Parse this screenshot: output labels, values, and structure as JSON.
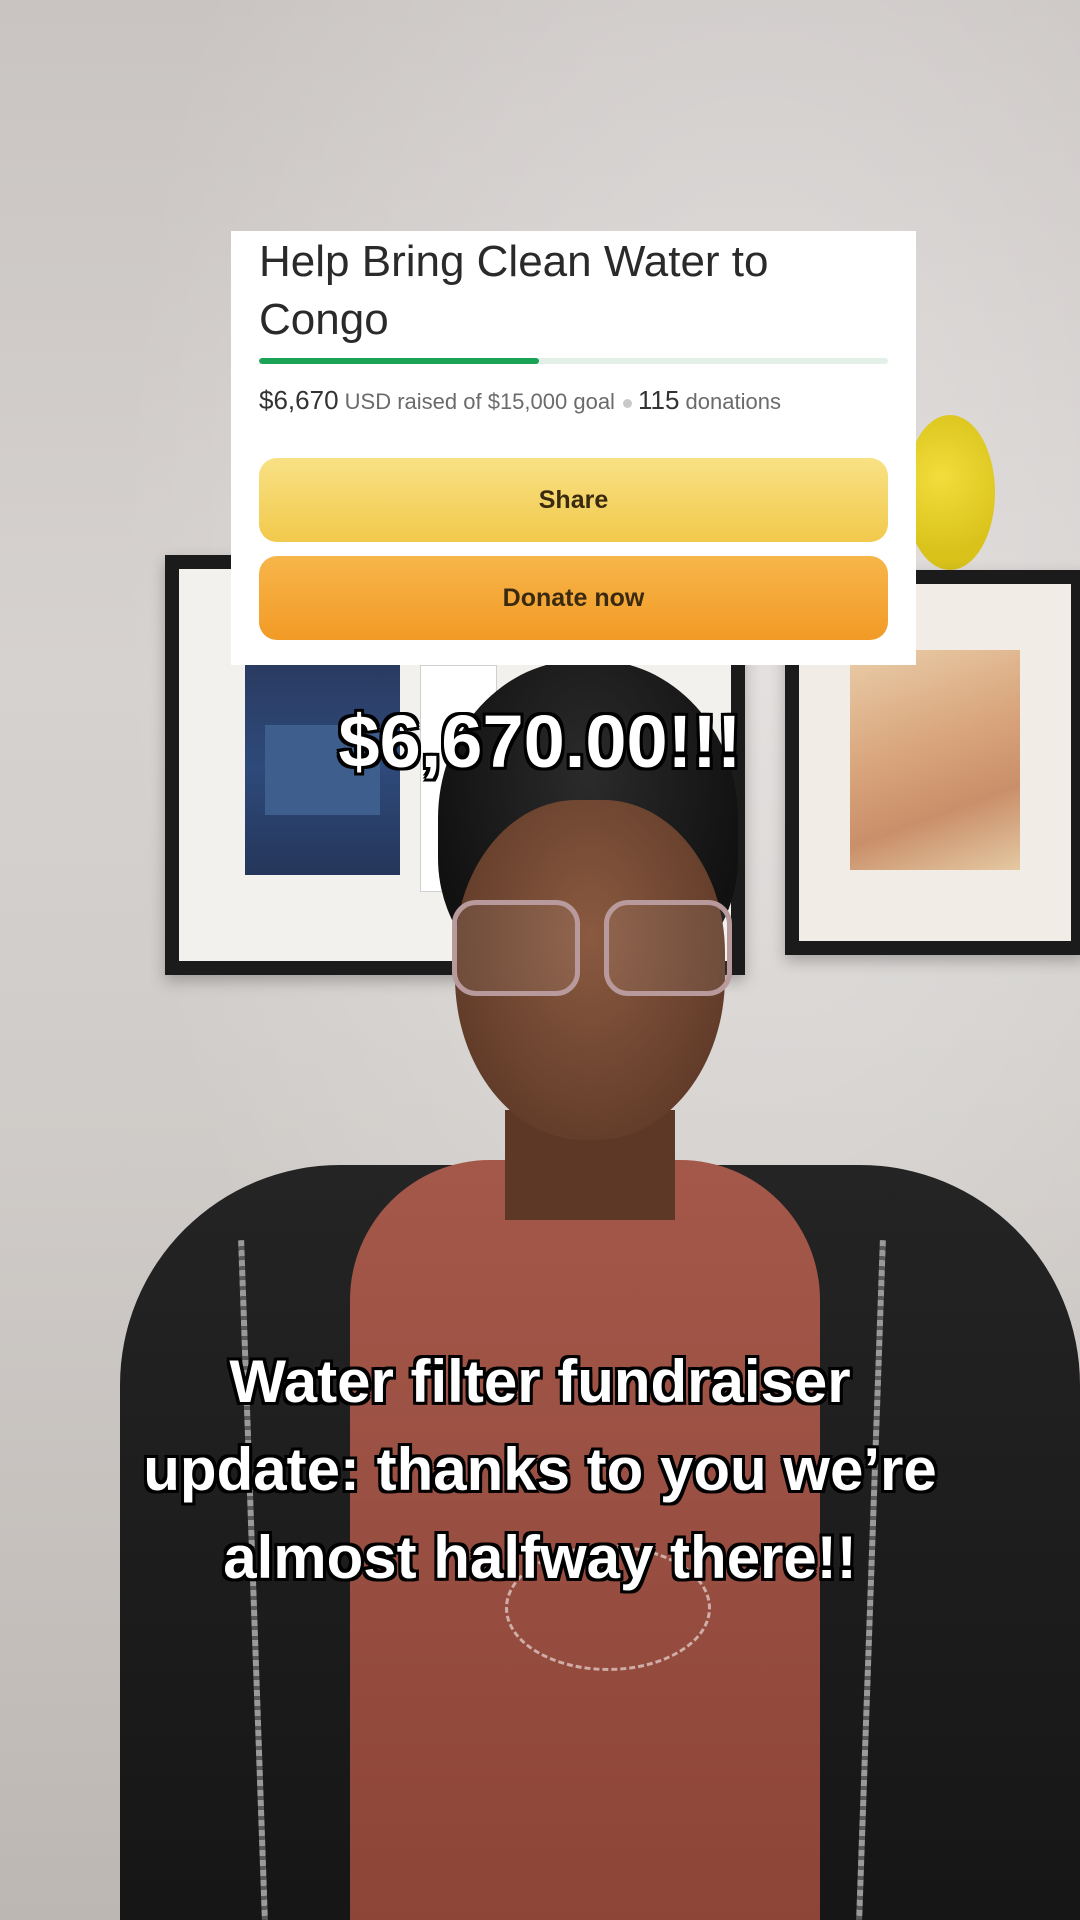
{
  "fundraiser": {
    "title": "Help Bring Clean Water to Congo",
    "raised_amount": "$6,670",
    "raised_text": "USD raised of $15,000 goal",
    "donations_count": "115",
    "donations_label": "donations",
    "progress_fraction": 0.4447,
    "share_label": "Share",
    "donate_label": "Donate now"
  },
  "overlay": {
    "amount_caption": "$6,670.00!!!",
    "message_caption": "Water filter fundraiser update: thanks to you we’re almost halfway there!!"
  },
  "colors": {
    "progress": "#1aa257",
    "share_button": "#f2c94c",
    "donate_button": "#f29a26"
  }
}
